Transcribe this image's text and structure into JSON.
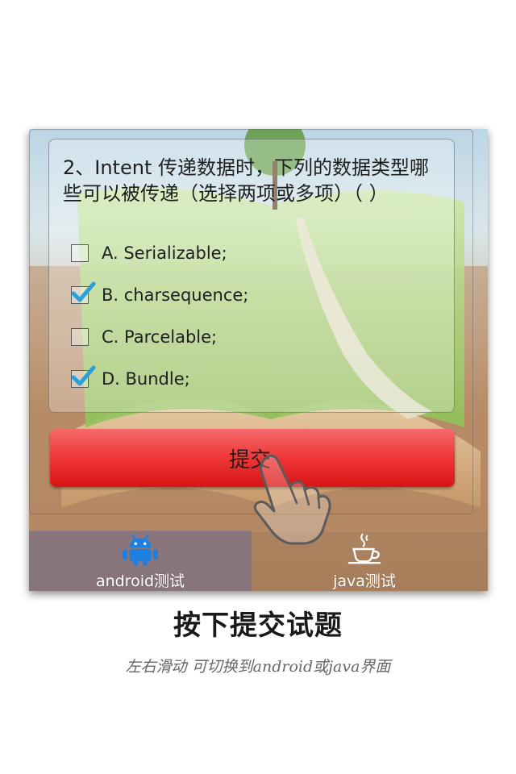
{
  "question": {
    "text": "2、Intent 传递数据时，下列的数据类型哪些可以被传递（选择两项或多项）（ ）"
  },
  "options": [
    {
      "label": "A. Serializable;",
      "checked": false
    },
    {
      "label": "B. charsequence;",
      "checked": true
    },
    {
      "label": "C. Parcelable;",
      "checked": false
    },
    {
      "label": "D. Bundle;",
      "checked": true
    }
  ],
  "submit": {
    "label": "提交"
  },
  "tabs": [
    {
      "label": "android测试",
      "icon": "android-icon",
      "selected": true
    },
    {
      "label": "java测试",
      "icon": "coffee-cup-icon",
      "selected": false
    }
  ],
  "caption": {
    "title": "按下提交试题",
    "subtitle": "左右滑动 可切换到android或java界面"
  },
  "colors": {
    "button": "#ef3737",
    "check": "#2a9fd8",
    "tab_selected": "#6e6e96"
  }
}
